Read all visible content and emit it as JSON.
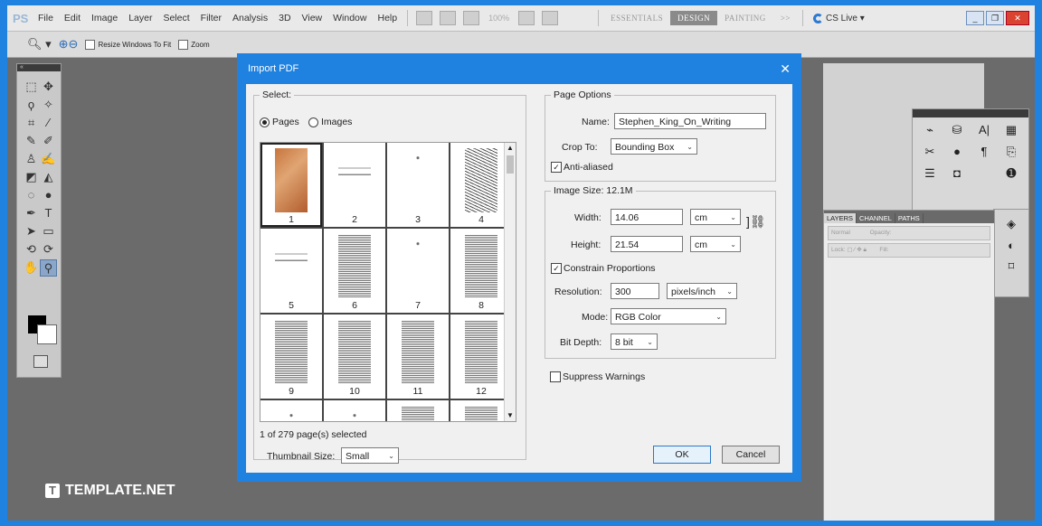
{
  "app": {
    "logo": "PS",
    "menu": [
      "File",
      "Edit",
      "Image",
      "Layer",
      "Select",
      "Filter",
      "Analysis",
      "3D",
      "View",
      "Window",
      "Help"
    ],
    "zoom_readout": "100%",
    "workspaces": [
      "ESSENTIALS",
      "DESIGN",
      "PAINTING"
    ],
    "workspace_more": ">>",
    "cslive": "CS Live ▾",
    "active_workspace": "DESIGN"
  },
  "options_bar": {
    "resize_label": "Resize Windows To Fit",
    "zoom_all_label": "Zoom"
  },
  "layers_panel": {
    "tabs": [
      "LAYERS",
      "CHANNEL",
      "PATHS"
    ],
    "blend_mode": "Normal",
    "opacity_label": "Opacity:",
    "lock_label": "Lock:",
    "fill_label": "Fill:"
  },
  "watermark": {
    "icon": "T",
    "text": "TEMPLATE.NET"
  },
  "dialog": {
    "title": "Import PDF",
    "close": "✕",
    "select": {
      "legend": "Select:",
      "pages_label": "Pages",
      "images_label": "Images",
      "selected_option": "Pages",
      "pages": [
        {
          "n": "1",
          "kind": "cover",
          "selected": true
        },
        {
          "n": "2",
          "kind": "sparse"
        },
        {
          "n": "3",
          "kind": "blank"
        },
        {
          "n": "4",
          "kind": "scan"
        },
        {
          "n": "5",
          "kind": "sparse"
        },
        {
          "n": "6",
          "kind": "text"
        },
        {
          "n": "7",
          "kind": "blank"
        },
        {
          "n": "8",
          "kind": "text"
        },
        {
          "n": "9",
          "kind": "text"
        },
        {
          "n": "10",
          "kind": "text"
        },
        {
          "n": "11",
          "kind": "text"
        },
        {
          "n": "12",
          "kind": "text"
        },
        {
          "n": "",
          "kind": "blank"
        },
        {
          "n": "",
          "kind": "blank"
        },
        {
          "n": "",
          "kind": "text"
        },
        {
          "n": "",
          "kind": "text"
        }
      ],
      "status": "1 of 279 page(s) selected",
      "thumb_size_label": "Thumbnail Size:",
      "thumb_size_value": "Small"
    },
    "page_options": {
      "legend": "Page Options",
      "name_label": "Name:",
      "name_value": "Stephen_King_On_Writing",
      "crop_label": "Crop To:",
      "crop_value": "Bounding Box",
      "antialiased_label": "Anti-aliased",
      "antialiased_checked": "✓"
    },
    "image_size": {
      "legend": "Image Size: 12.1M",
      "width_label": "Width:",
      "width_value": "14.06",
      "width_unit": "cm",
      "height_label": "Height:",
      "height_value": "21.54",
      "height_unit": "cm",
      "constrain_label": "Constrain Proportions",
      "constrain_checked": "✓",
      "resolution_label": "Resolution:",
      "resolution_value": "300",
      "resolution_unit": "pixels/inch",
      "mode_label": "Mode:",
      "mode_value": "RGB Color",
      "depth_label": "Bit Depth:",
      "depth_value": "8 bit"
    },
    "suppress_label": "Suppress Warnings",
    "ok_label": "OK",
    "cancel_label": "Cancel"
  }
}
